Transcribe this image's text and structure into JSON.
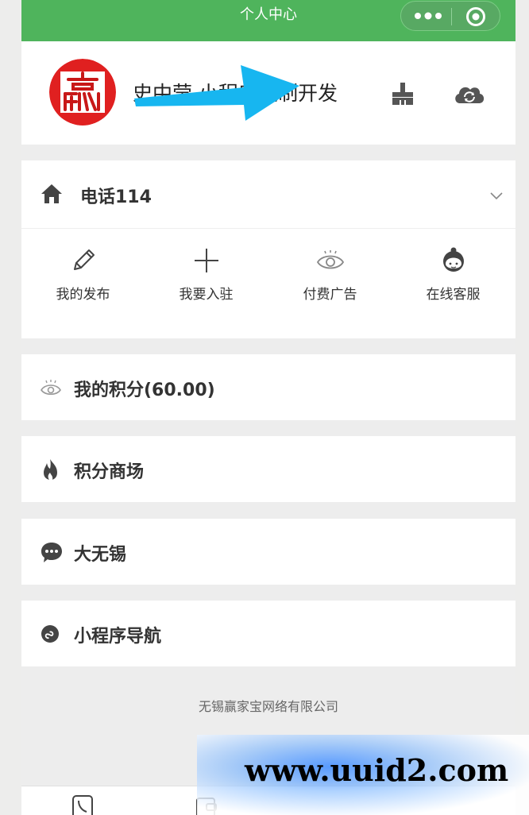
{
  "header": {
    "title": "个人中心"
  },
  "user": {
    "name": "史中莹 小程序定制开发"
  },
  "phone_section": {
    "title": "电话114"
  },
  "grid": [
    {
      "label": "我的发布",
      "icon": "pencil-icon"
    },
    {
      "label": "我要入驻",
      "icon": "plus-icon"
    },
    {
      "label": "付费广告",
      "icon": "eye-icon"
    },
    {
      "label": "在线客服",
      "icon": "customer-service-icon"
    }
  ],
  "menu": [
    {
      "label": "我的积分(60.00)",
      "icon": "eye-icon"
    },
    {
      "label": "积分商场",
      "icon": "flame-icon"
    },
    {
      "label": "大无锡",
      "icon": "chat-bubble-icon"
    },
    {
      "label": "小程序导航",
      "icon": "miniprogram-icon"
    }
  ],
  "footer": {
    "company": "无锡赢家宝网络有限公司"
  },
  "watermark": {
    "text": "www.uuid2.com"
  },
  "colors": {
    "header_green": "#4fb45c",
    "arrow_cyan": "#17b6f0",
    "avatar_red": "#e02020"
  }
}
